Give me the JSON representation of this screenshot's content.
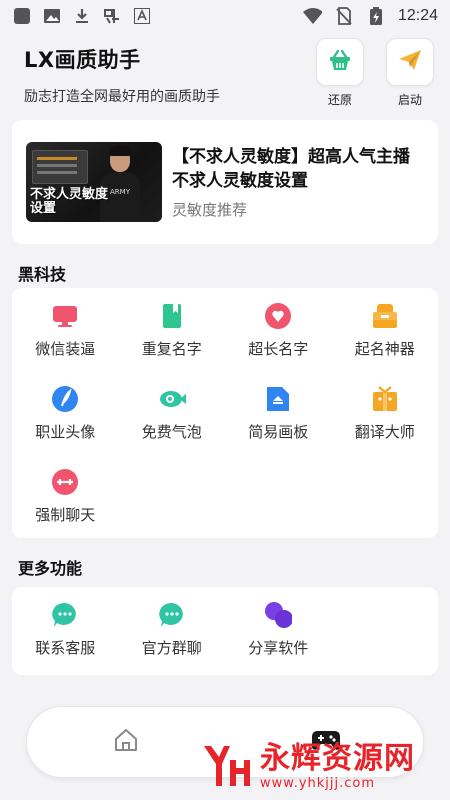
{
  "status_bar": {
    "time": "12:24",
    "left_icons": [
      "square-icon",
      "image-icon",
      "download-icon",
      "custom-app-icon",
      "a-badge-icon"
    ],
    "right_icons": [
      "wifi-icon",
      "no-sim-icon",
      "battery-charging-icon"
    ]
  },
  "header": {
    "title": "LX画质助手",
    "subtitle": "励志打造全网最好用的画质助手"
  },
  "top_actions": [
    {
      "label": "还原",
      "icon": "basket-icon",
      "color": "#2fc08a"
    },
    {
      "label": "启动",
      "icon": "paper-plane-icon",
      "color": "#f2b53a"
    }
  ],
  "featured": {
    "title": "【不求人灵敏度】超高人气主播不求人灵敏度设置",
    "subtitle": "灵敏度推荐",
    "thumbnail_text": "不求人灵敏度设置",
    "thumbnail_shirt_text": "ARMY"
  },
  "sections": {
    "black_tech": {
      "title": "黑科技",
      "items": [
        {
          "label": "微信装逼",
          "icon": "monitor-icon",
          "color": "#f0546e"
        },
        {
          "label": "重复名字",
          "icon": "bookmark-icon",
          "color": "#2fc58f"
        },
        {
          "label": "超长名字",
          "icon": "heart-bubble-icon",
          "color": "#f0546e"
        },
        {
          "label": "起名神器",
          "icon": "stack-icon",
          "color": "#f5a623"
        },
        {
          "label": "职业头像",
          "icon": "feather-icon",
          "color": "#2f86f0"
        },
        {
          "label": "免费气泡",
          "icon": "fish-icon",
          "color": "#2fc5a4"
        },
        {
          "label": "简易画板",
          "icon": "document-icon",
          "color": "#2f86f0"
        },
        {
          "label": "翻译大师",
          "icon": "gift-icon",
          "color": "#f5a623"
        },
        {
          "label": "强制聊天",
          "icon": "chat-circle-icon",
          "color": "#f0546e"
        }
      ]
    },
    "more": {
      "title": "更多功能",
      "items": [
        {
          "label": "联系客服",
          "icon": "chat-bubble-icon",
          "color": "#2fc5a4"
        },
        {
          "label": "官方群聊",
          "icon": "chat-bubble-icon",
          "color": "#2fc5a4"
        },
        {
          "label": "分享软件",
          "icon": "share-circles-icon",
          "color": "#7b3fe4"
        }
      ]
    }
  },
  "bottom_nav": {
    "items": [
      {
        "icon": "home-icon"
      },
      {
        "icon": "gamepad-icon"
      }
    ]
  },
  "watermark": {
    "main": "永辉资源网",
    "url": "www.yhkjjj.com"
  }
}
